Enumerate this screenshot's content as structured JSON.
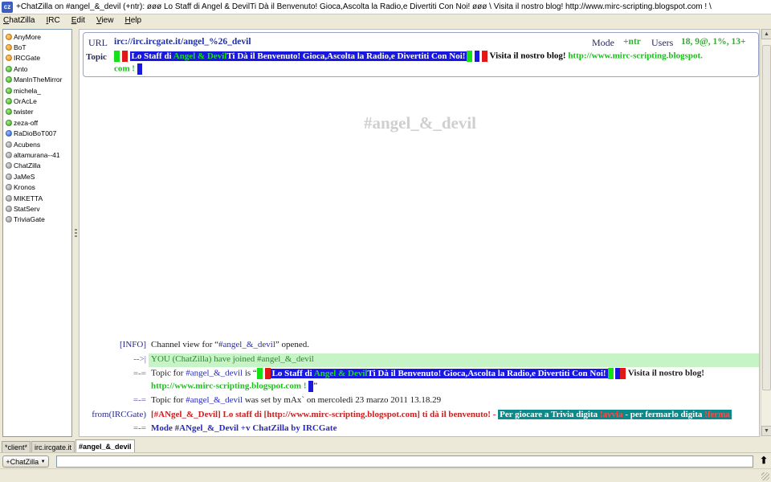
{
  "window": {
    "icon_text": "cz",
    "title": "+ChatZilla on #angel_&_devil (+ntr): øøø Lo Staff di Angel & DevilTi Dà il Benvenuto! Gioca,Ascolta la Radio,e Divertiti Con Noi! øøø \\ Visita il nostro blog! http://www.mirc-scripting.blogspot.com ! \\"
  },
  "menu": {
    "chatzilla": {
      "accel": "C",
      "rest": "hatZilla"
    },
    "irc": {
      "accel": "I",
      "rest": "RC"
    },
    "edit": {
      "accel": "E",
      "rest": "dit"
    },
    "view": {
      "accel": "V",
      "rest": "iew"
    },
    "help": {
      "accel": "H",
      "rest": "elp"
    }
  },
  "users": [
    {
      "nick": "AnyMore",
      "status": "op"
    },
    {
      "nick": "BoT",
      "status": "op"
    },
    {
      "nick": "IRCGate",
      "status": "op"
    },
    {
      "nick": "Anto",
      "status": "voice"
    },
    {
      "nick": "ManInTheMirror",
      "status": "voice"
    },
    {
      "nick": "michela_",
      "status": "voice"
    },
    {
      "nick": "OrAcLe",
      "status": "voice"
    },
    {
      "nick": "twister",
      "status": "voice"
    },
    {
      "nick": "zeza-off",
      "status": "voice"
    },
    {
      "nick": "RaDioBoT007",
      "status": "halfop"
    },
    {
      "nick": "Acubens",
      "status": "normal"
    },
    {
      "nick": "altamurana--41",
      "status": "normal"
    },
    {
      "nick": "ChatZilla",
      "status": "normal"
    },
    {
      "nick": "JaMeS",
      "status": "normal"
    },
    {
      "nick": "Kronos",
      "status": "normal"
    },
    {
      "nick": "MIKETTA",
      "status": "normal"
    },
    {
      "nick": "StatServ",
      "status": "normal"
    },
    {
      "nick": "TriviaGate",
      "status": "normal"
    }
  ],
  "header": {
    "url_label": "URL",
    "url_value": "irc://irc.ircgate.it/angel_%26_devil",
    "mode_label": "Mode",
    "mode_value": "+ntr",
    "users_label": "Users",
    "users_value": "18, 9@, 1%, 13+",
    "topic_label": "Topic",
    "topic": {
      "staff_prefix": "Lo Staff di ",
      "staff_name": "Angel & Devil",
      "welcome": "Ti Dà il Benvenuto! Gioca,Ascolta la Radio,e Divertiti Con Noi!",
      "visit": " Visita il nostro blog! ",
      "blog_url_part1": "http://www.mirc-scripting.blogspot.",
      "blog_url_part2": "com !"
    }
  },
  "channel_name": "#angel_&_devil",
  "messages": {
    "m1": {
      "nick": "[INFO]",
      "pre": "Channel view for “",
      "chan": "#angel_&_devil",
      "post": "” opened."
    },
    "m2": {
      "nick": "-->|",
      "text": "YOU (ChatZilla) have joined #angel_&_devil"
    },
    "m3": {
      "nick": "=-=",
      "pre": "Topic for ",
      "chan": "#angel_&_devil",
      "mid": " is “",
      "visit": " Visita il nostro blog!",
      "url": "http://www.mirc-scripting.blogspot.com !",
      "close": "”"
    },
    "m4": {
      "nick": "=-=",
      "pre": "Topic for ",
      "chan": "#angel_&_devil",
      "post": " was set by mAx` on mercoledì 23 marzo 2011 13.18.29"
    },
    "m5": {
      "nick": "from(IRCGate)",
      "red_text": "[#ANgel_&_Devil] Lo staff di [http://www.mirc-scripting.blogspot.com] ti dà il benvenuto! - ",
      "teal_pre": "Per giocare a Trivia digita ",
      "avvia": "!avvia",
      "teal_mid": " - per fermarlo digita ",
      "ferma": "!ferma"
    },
    "m6": {
      "nick": "=-=",
      "text": "Mode #ANgel_&_Devil +v ChatZilla by IRCGate"
    }
  },
  "tabs": [
    {
      "label": "*client*",
      "active": false
    },
    {
      "label": "irc.ircgate.it",
      "active": false
    },
    {
      "label": "#angel_&_devil",
      "active": true
    }
  ],
  "input": {
    "nick_button": "+ChatZilla",
    "value": ""
  }
}
